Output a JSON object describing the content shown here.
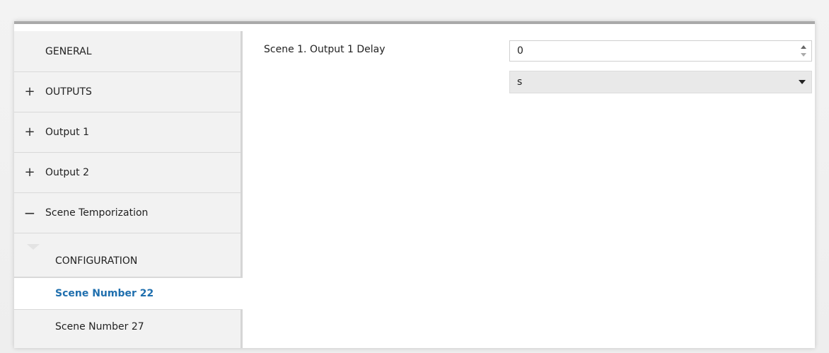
{
  "sidebar": {
    "items": [
      {
        "toggle": "",
        "label": "GENERAL"
      },
      {
        "toggle": "+",
        "label": "OUTPUTS"
      },
      {
        "toggle": "+",
        "label": "Output 1"
      },
      {
        "toggle": "+",
        "label": "Output 2"
      },
      {
        "toggle": "−",
        "label": "Scene Temporization"
      }
    ],
    "sub_items": [
      {
        "label": "CONFIGURATION",
        "active": false
      },
      {
        "label": "Scene Number 22",
        "active": true
      },
      {
        "label": "Scene Number 27",
        "active": false
      }
    ]
  },
  "content": {
    "field_label": "Scene 1. Output 1 Delay",
    "delay_value": "0",
    "unit_selected": "s"
  },
  "icons": {
    "plus": "plus-icon",
    "minus": "minus-icon",
    "spinner": "spinner-icon",
    "dropdown": "chevron-down-icon"
  },
  "colors": {
    "active_text": "#1f6fae",
    "sidebar_bg": "#f2f2f2"
  }
}
